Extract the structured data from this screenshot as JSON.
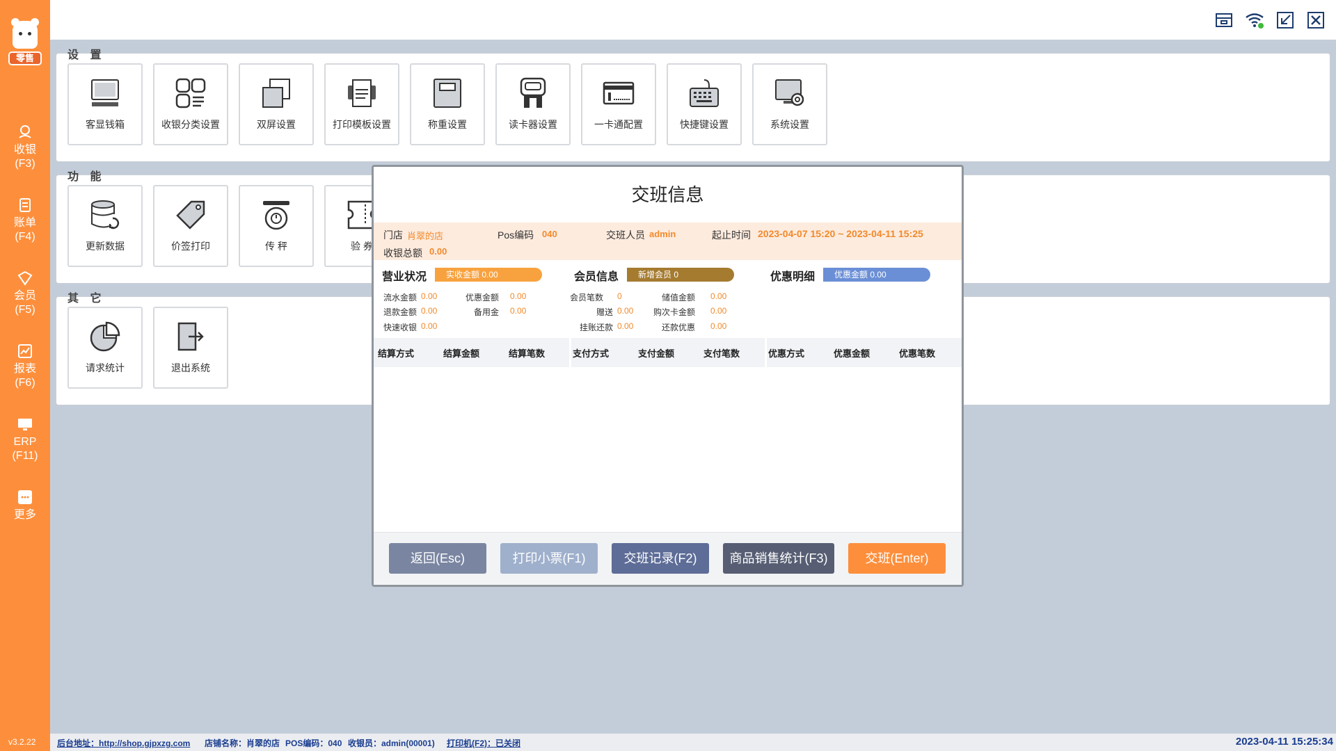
{
  "app": {
    "logo_text": "零售",
    "version": "v3.2.22"
  },
  "sidebar": {
    "items": [
      {
        "label": "收银",
        "key": "(F3)",
        "icon": "cashier-icon"
      },
      {
        "label": "账单",
        "key": "(F4)",
        "icon": "bill-icon"
      },
      {
        "label": "会员",
        "key": "(F5)",
        "icon": "member-icon"
      },
      {
        "label": "报表",
        "key": "(F6)",
        "icon": "report-icon"
      },
      {
        "label": "ERP",
        "key": "(F11)",
        "icon": "erp-icon"
      },
      {
        "label": "更多",
        "key": "",
        "icon": "more-icon"
      }
    ]
  },
  "sections": {
    "settings": {
      "title": "设 置",
      "tiles": [
        "客显钱箱",
        "收银分类设置",
        "双屏设置",
        "打印模板设置",
        "称重设置",
        "读卡器设置",
        "一卡通配置",
        "快捷键设置",
        "系统设置"
      ]
    },
    "functions": {
      "title": "功 能",
      "tiles": [
        "更新数据",
        "价签打印",
        "传 秤",
        "验 券"
      ]
    },
    "others": {
      "title": "其 它",
      "tiles": [
        "请求统计",
        "退出系统"
      ]
    }
  },
  "modal": {
    "title": "交班信息",
    "store_label": "门店",
    "store_value": "肖翠的店",
    "pos_label": "Pos编码",
    "pos_value": "040",
    "staff_label": "交班人员",
    "staff_value": "admin",
    "period_label": "起止时间",
    "period_value": "2023-04-07 15:20 ~ 2023-04-11 15:25",
    "total_label": "收银总额",
    "total_value": "0.00",
    "business": {
      "title": "营业状况",
      "pill": "实收金额  0.00",
      "rows": [
        {
          "label": "流水金额",
          "value": "0.00"
        },
        {
          "label": "优惠金额",
          "value": "0.00"
        },
        {
          "label": "退款金额",
          "value": "0.00"
        },
        {
          "label": "备用金",
          "value": "0.00"
        },
        {
          "label": "快速收银",
          "value": "0.00"
        }
      ]
    },
    "member": {
      "title": "会员信息",
      "pill": "新增会员  0",
      "rows": [
        {
          "label": "会员笔数",
          "value": "0"
        },
        {
          "label": "储值金额",
          "value": "0.00"
        },
        {
          "label": "赠送",
          "value": "0.00"
        },
        {
          "label": "购次卡金额",
          "value": "0.00"
        },
        {
          "label": "挂账还款",
          "value": "0.00"
        },
        {
          "label": "还款优惠",
          "value": "0.00"
        }
      ]
    },
    "discount": {
      "title": "优惠明细",
      "pill": "优惠金额 0.00"
    },
    "table_headers": [
      "结算方式",
      "结算金额",
      "结算笔数",
      "支付方式",
      "支付金额",
      "支付笔数",
      "优惠方式",
      "优惠金额",
      "优惠笔数"
    ],
    "buttons": [
      "返回(Esc)",
      "打印小票(F1)",
      "交班记录(F2)",
      "商品销售统计(F3)",
      "交班(Enter)"
    ]
  },
  "statusbar": {
    "backend": "后台地址：http://shop.gjpxzg.com",
    "store": "店铺名称：肖翠的店",
    "pos": "POS编码：040",
    "cashier": "收银员：admin(00001)",
    "printer": "打印机(F2)：已关闭",
    "datetime": "2023-04-11 15:25:34"
  },
  "colors": {
    "sidebar": "#fd8f3c",
    "accent": "#f18a2c",
    "pill_business": "#f8a23f",
    "pill_member": "#a57b30",
    "pill_discount": "#6b8fd6",
    "btn_back": "#7a86a1",
    "btn_print": "#9fb0cc",
    "btn_record": "#5e6d97",
    "btn_stats": "#575e73",
    "btn_shift": "#fd8f3c"
  }
}
